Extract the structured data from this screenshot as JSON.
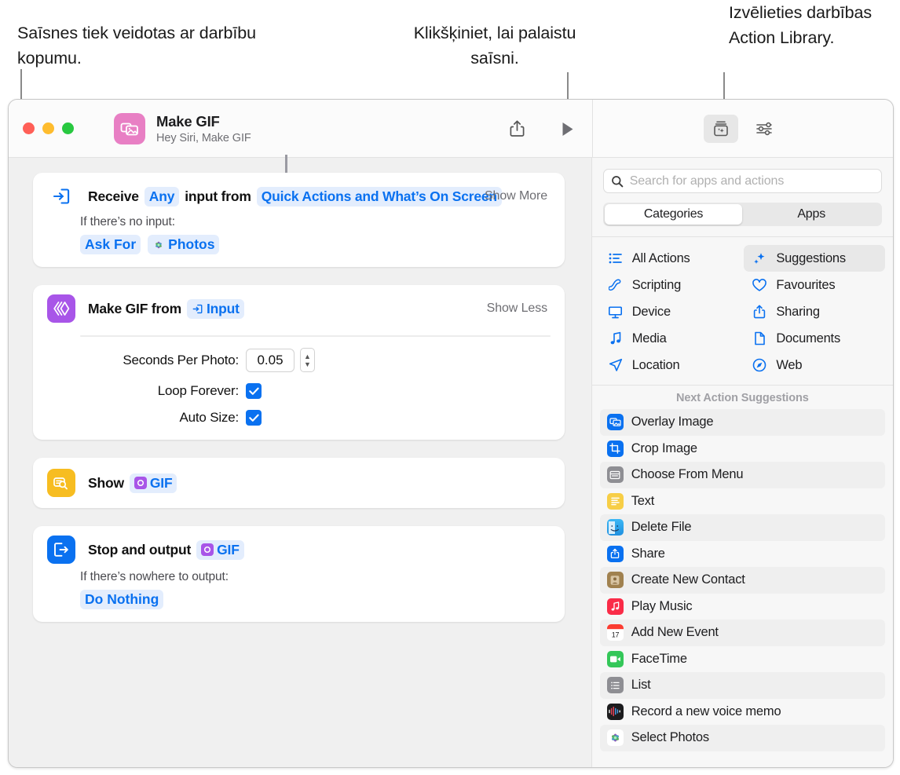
{
  "callouts": {
    "left": "Saīsnes tiek veidotas ar darbību kopumu.",
    "middle": "Klikšķiniet, lai palaistu saīsni.",
    "right": "Izvēlieties darbības Action Library."
  },
  "window": {
    "title": "Make GIF",
    "subtitle": "Hey Siri, Make GIF",
    "app_icon": "photos-stack-icon",
    "toolbar": {
      "share_label": "share-icon",
      "run_label": "play-icon",
      "library_label": "action-library-icon",
      "settings_label": "sliders-icon"
    }
  },
  "editor": {
    "cards": [
      {
        "id": "receive",
        "icon": "receive-input-icon",
        "icon_color": "#0a71f0",
        "icon_style": "outline",
        "title_parts": [
          {
            "type": "text",
            "text": "Receive"
          },
          {
            "type": "token",
            "text": "Any"
          },
          {
            "type": "text",
            "text": "input from"
          },
          {
            "type": "token",
            "text": "Quick Actions and What’s On Screen"
          }
        ],
        "toggle": "Show More",
        "sub_label": "If there’s no input:",
        "tokens": [
          {
            "text": "Ask For",
            "icon": null
          },
          {
            "text": "Photos",
            "icon": "photos-app-icon"
          }
        ]
      },
      {
        "id": "makegif",
        "icon": "make-gif-icon",
        "icon_color": "#a855e8",
        "icon_style": "filled",
        "title_parts": [
          {
            "type": "text",
            "text": "Make GIF from"
          },
          {
            "type": "token",
            "text": "Input",
            "icon": "input-arrow-icon"
          }
        ],
        "toggle": "Show Less",
        "params": [
          {
            "label": "Seconds Per Photo:",
            "type": "number",
            "value": "0.05"
          },
          {
            "label": "Loop Forever:",
            "type": "checkbox",
            "checked": true
          },
          {
            "label": "Auto Size:",
            "type": "checkbox",
            "checked": true
          }
        ]
      },
      {
        "id": "show",
        "icon": "quick-look-icon",
        "icon_color": "#f7bd21",
        "icon_style": "filled",
        "title_parts": [
          {
            "type": "text",
            "text": "Show"
          },
          {
            "type": "token",
            "text": "GIF",
            "icon": "gif-variable-icon"
          }
        ]
      },
      {
        "id": "stop",
        "icon": "stop-output-icon",
        "icon_color": "#0a71f0",
        "icon_style": "filled",
        "title_parts": [
          {
            "type": "text",
            "text": "Stop and output"
          },
          {
            "type": "token",
            "text": "GIF",
            "icon": "gif-variable-icon"
          }
        ],
        "sub_label": "If there’s nowhere to output:",
        "tokens": [
          {
            "text": "Do Nothing",
            "icon": null
          }
        ]
      }
    ]
  },
  "sidebar": {
    "search": {
      "placeholder": "Search for apps and actions",
      "icon": "search-icon"
    },
    "segmented": {
      "options": [
        "Categories",
        "Apps"
      ],
      "selected": "Categories"
    },
    "categories": [
      {
        "label": "All Actions",
        "icon": "list-bullet-icon",
        "active": false
      },
      {
        "label": "Suggestions",
        "icon": "sparkles-icon",
        "active": true
      },
      {
        "label": "Scripting",
        "icon": "scripting-icon",
        "active": false
      },
      {
        "label": "Favourites",
        "icon": "heart-icon",
        "active": false
      },
      {
        "label": "Device",
        "icon": "display-icon",
        "active": false
      },
      {
        "label": "Sharing",
        "icon": "share-icon",
        "active": false
      },
      {
        "label": "Media",
        "icon": "music-note-icon",
        "active": false
      },
      {
        "label": "Documents",
        "icon": "document-icon",
        "active": false
      },
      {
        "label": "Location",
        "icon": "paper-plane-icon",
        "active": false
      },
      {
        "label": "Web",
        "icon": "safari-icon",
        "active": false
      }
    ],
    "suggestions_header": "Next Action Suggestions",
    "suggestions": [
      {
        "label": "Overlay Image",
        "icon": "overlay-image-icon",
        "color": "#0a71f0"
      },
      {
        "label": "Crop Image",
        "icon": "crop-image-icon",
        "color": "#0a71f0"
      },
      {
        "label": "Choose From Menu",
        "icon": "choose-menu-icon",
        "color": "#8e8e93"
      },
      {
        "label": "Text",
        "icon": "text-icon",
        "color": "#f7ce46"
      },
      {
        "label": "Delete File",
        "icon": "finder-icon",
        "color": "#2aa3f0"
      },
      {
        "label": "Share",
        "icon": "share-action-icon",
        "color": "#0a71f0"
      },
      {
        "label": "Create New Contact",
        "icon": "contacts-icon",
        "color": "#a0814f"
      },
      {
        "label": "Play Music",
        "icon": "music-app-icon",
        "color": "#fa2c48"
      },
      {
        "label": "Add New Event",
        "icon": "calendar-icon",
        "color": "#ffffff"
      },
      {
        "label": "FaceTime",
        "icon": "facetime-icon",
        "color": "#34c759"
      },
      {
        "label": "List",
        "icon": "list-icon",
        "color": "#8e8e93"
      },
      {
        "label": "Record a new voice memo",
        "icon": "voice-memos-icon",
        "color": "#1c1c1e"
      },
      {
        "label": "Select Photos",
        "icon": "photos-app-icon",
        "color": "#ffffff"
      }
    ]
  },
  "colors": {
    "accent_blue": "#0a71f0",
    "token_bg": "#e3edfd",
    "purple": "#a855e8",
    "yellow": "#f7bd21",
    "window_bg": "#f0f0f0"
  }
}
